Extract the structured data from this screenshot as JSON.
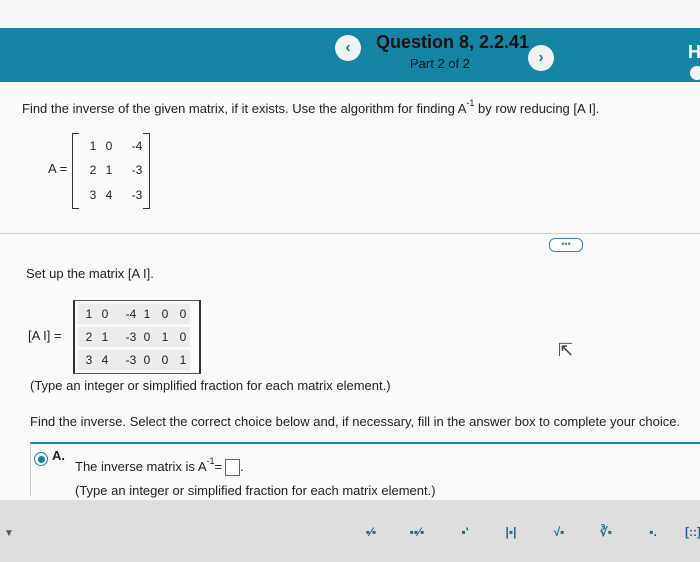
{
  "header": {
    "title": "Question 8, 2.2.41",
    "subtitle": "Part 2 of 2",
    "prev_icon": "‹",
    "next_icon": "›",
    "right_cut": "H"
  },
  "prompt": {
    "line1_a": "Find the inverse of the given matrix, if it exists. Use the algorithm for finding A",
    "line1_sup": "-1",
    "line1_b": "by row reducing [A  I].",
    "matrix_label": "A =",
    "matrix": [
      [
        "1",
        "0",
        "-4"
      ],
      [
        "2",
        "1",
        "-3"
      ],
      [
        "3",
        "4",
        "-3"
      ]
    ]
  },
  "more_label": "•••",
  "setup": {
    "instruction": "Set up the matrix [A  I].",
    "label": "[A  I] =",
    "rows": [
      [
        "1",
        "0",
        "-4",
        "1",
        "0",
        "0"
      ],
      [
        "2",
        "1",
        "-3",
        "0",
        "1",
        "0"
      ],
      [
        "3",
        "4",
        "-3",
        "0",
        "0",
        "1"
      ]
    ],
    "note": "(Type an integer or simplified fraction for each matrix element.)"
  },
  "inverse": {
    "instruction": "Find the inverse. Select the correct choice below and, if necessary, fill in the answer box to complete your choice.",
    "choice_letter": "A.",
    "choice_text": "The inverse matrix is A",
    "choice_sup": "-1",
    "choice_eq": "=",
    "choice_period": ".",
    "choice_note": "(Type an integer or simplified fraction for each matrix element.)"
  },
  "toolbar": {
    "tools": [
      "fraction-icon",
      "mixed-number-icon",
      "exponent-icon",
      "absolute-value-icon",
      "sqrt-icon",
      "nth-root-icon",
      "decimal-icon",
      "matrix-icon"
    ],
    "glyphs": [
      "▪⁄▪",
      "▪▪⁄▪",
      "▪'",
      "|▪|",
      "√▪",
      "∛▪",
      "▪.",
      "[::]"
    ]
  },
  "colors": {
    "accent": "#1585a6"
  }
}
